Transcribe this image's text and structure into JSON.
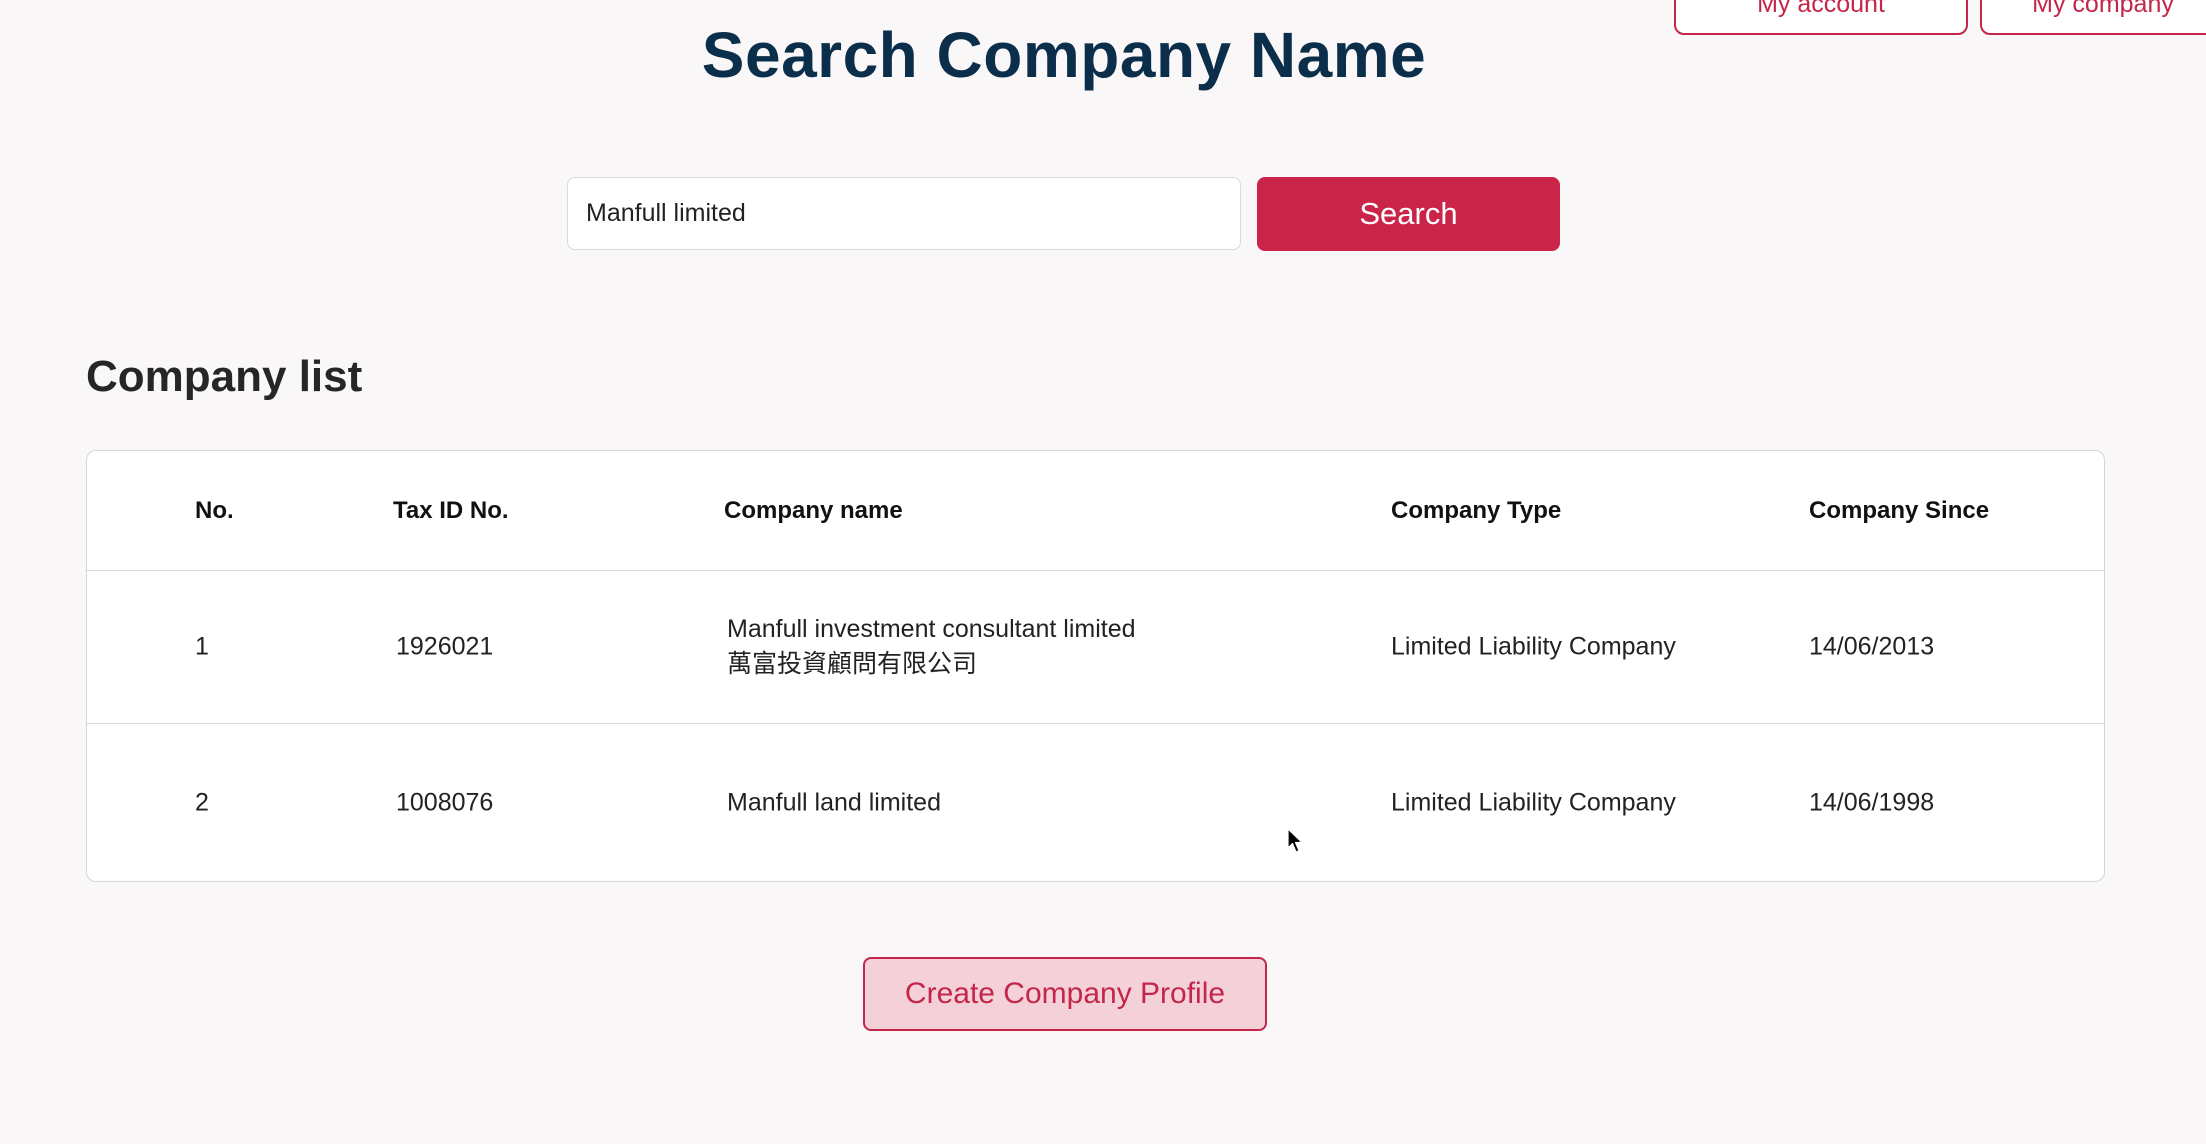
{
  "nav": {
    "account_label": "My account",
    "company_label": "My company"
  },
  "page": {
    "title": "Search Company Name"
  },
  "search": {
    "value": "Manfull limited",
    "button_label": "Search"
  },
  "company_list": {
    "title": "Company list",
    "columns": [
      "No.",
      "Tax ID No.",
      "Company name",
      "Company Type",
      "Company Since"
    ],
    "rows": [
      {
        "no": "1",
        "tax_id": "1926021",
        "name": "Manfull investment consultant limited",
        "name_zh": "萬富投資顧問有限公司",
        "type": "Limited Liability Company",
        "since": "14/06/2013"
      },
      {
        "no": "2",
        "tax_id": "1008076",
        "name": "Manfull land limited",
        "type": "Limited Liability Company",
        "since": "14/06/1998"
      }
    ]
  },
  "actions": {
    "create_label": "Create Company Profile"
  },
  "colors": {
    "title": "#0b2e4a",
    "accent": "#cb2449",
    "accent_light": "#f4d1d9",
    "background": "#f9f7f8"
  },
  "icons": {
    "cursor": "mouse-pointer-icon"
  }
}
